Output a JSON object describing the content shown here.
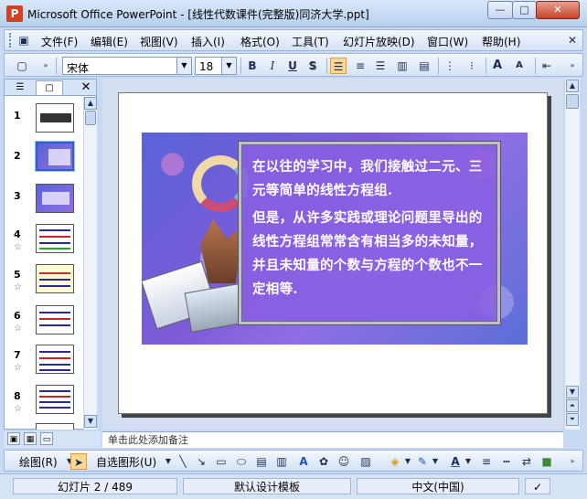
{
  "window": {
    "title": "Microsoft Office PowerPoint - [线性代数课件(完整版)同济大学.ppt]",
    "app_icon": "P",
    "min_label": "—",
    "max_label": "□",
    "close_label": "✕"
  },
  "menu": [
    "文件(F)",
    "编辑(E)",
    "视图(V)",
    "插入(I)",
    "格式(O)",
    "工具(T)",
    "幻灯片放映(D)",
    "窗口(W)",
    "帮助(H)"
  ],
  "toolbar": {
    "font_name": "宋体",
    "font_size": "18",
    "bold": "B",
    "italic": "I",
    "underline": "U",
    "shadow": "S",
    "grow_font": "A",
    "shrink_font": "A"
  },
  "left_pane": {
    "slides": [
      {
        "num": "1",
        "star": ""
      },
      {
        "num": "2",
        "star": ""
      },
      {
        "num": "3",
        "star": ""
      },
      {
        "num": "4",
        "star": "☆"
      },
      {
        "num": "5",
        "star": "☆"
      },
      {
        "num": "6",
        "star": "☆"
      },
      {
        "num": "7",
        "star": "☆"
      },
      {
        "num": "8",
        "star": "☆"
      }
    ],
    "selected_slide": 2,
    "close_label": "✕"
  },
  "slide": {
    "paragraphs": [
      "在以往的学习中，我们接触过二元、三元等简单的线性方程组.",
      "但是，从许多实践或理论问题里导出的线性方程组常常含有相当多的未知量，并且未知量的个数与方程的个数也不一定相等."
    ]
  },
  "notes": {
    "text": "单击此处添加备注"
  },
  "drawbar": {
    "draw_label": "绘图(R)",
    "autoshapes_label": "自选图形(U)"
  },
  "status": {
    "slide_pos": "幻灯片 2 / 489",
    "template": "默认设计模板",
    "language": "中文(中国)"
  }
}
